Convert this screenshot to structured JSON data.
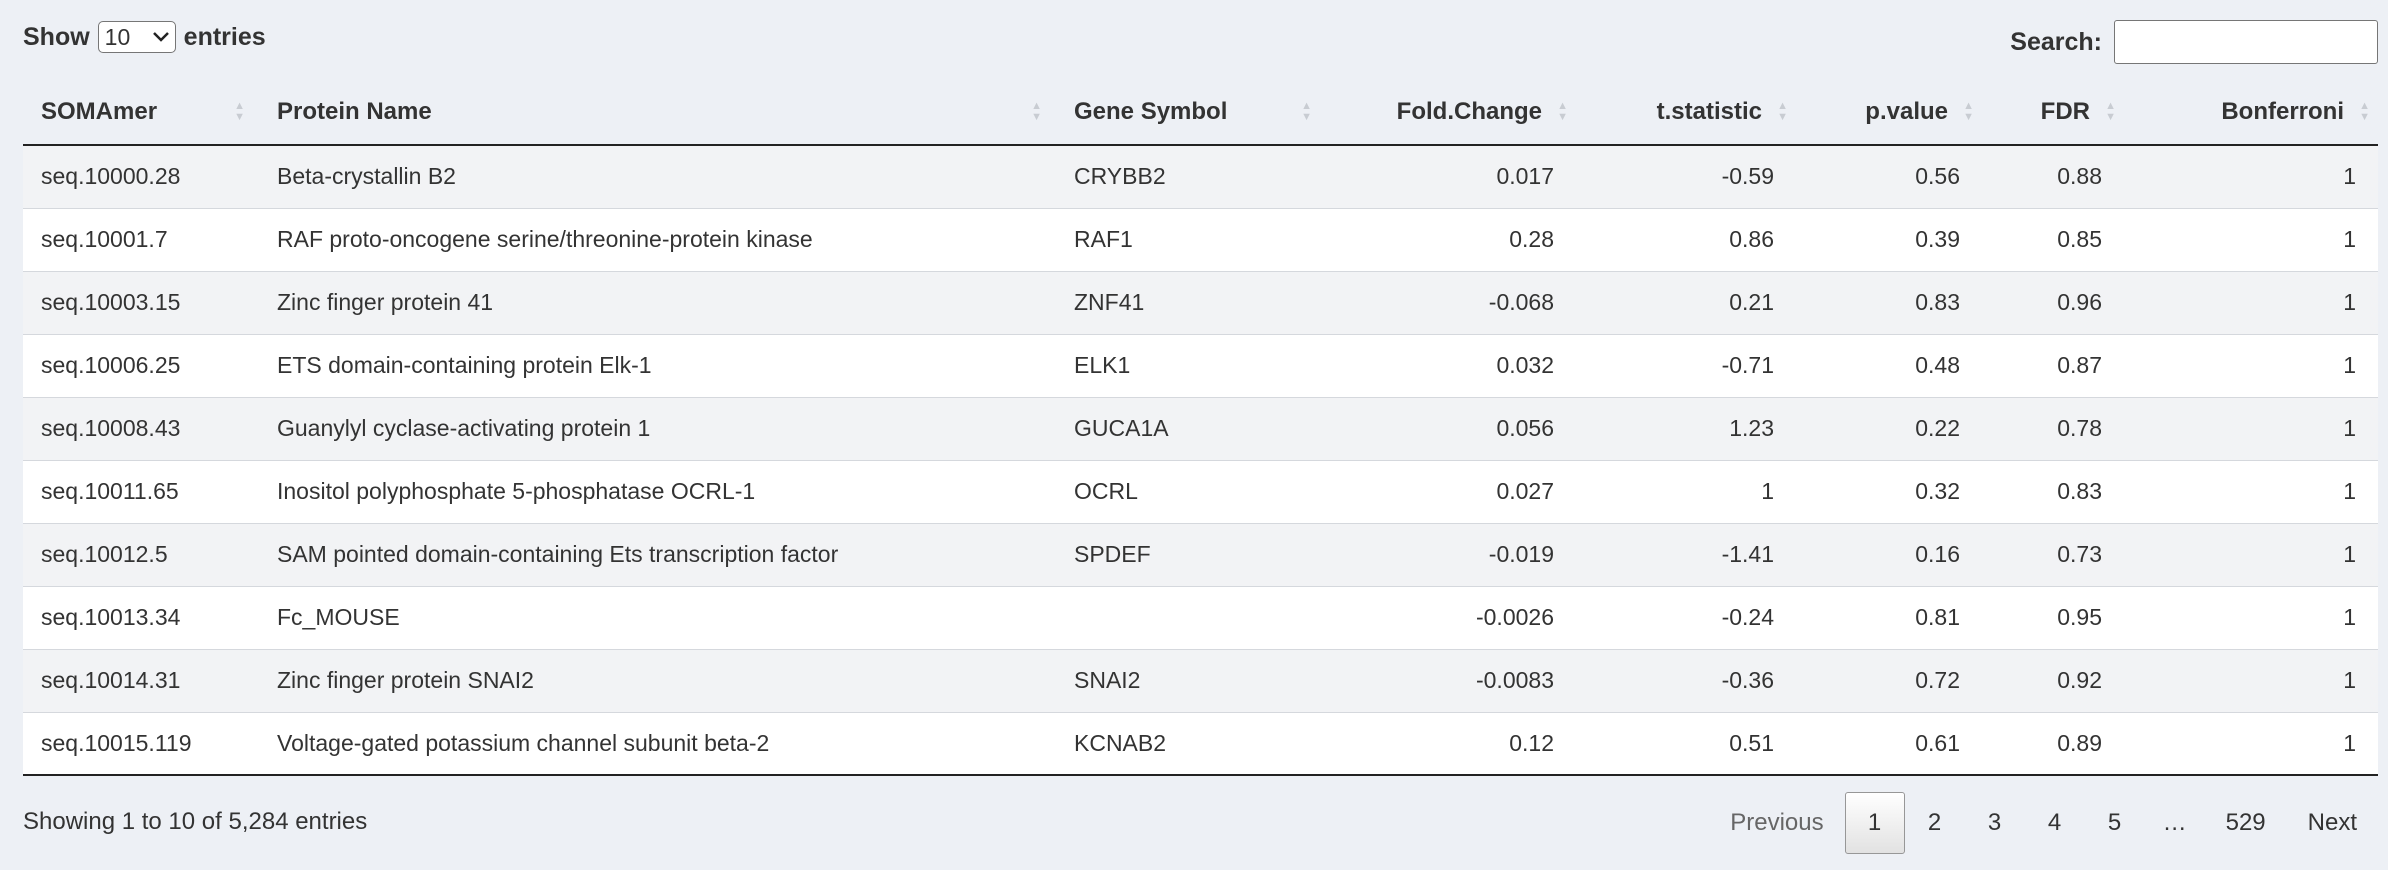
{
  "length_menu": {
    "show_label": "Show",
    "value": "10",
    "entries_label": "entries"
  },
  "search": {
    "label": "Search:",
    "value": ""
  },
  "columns": [
    {
      "label": "SOMAmer",
      "align": "left"
    },
    {
      "label": "Protein Name",
      "align": "left"
    },
    {
      "label": "Gene Symbol",
      "align": "left"
    },
    {
      "label": "Fold.Change",
      "align": "right"
    },
    {
      "label": "t.statistic",
      "align": "right"
    },
    {
      "label": "p.value",
      "align": "right"
    },
    {
      "label": "FDR",
      "align": "right"
    },
    {
      "label": "Bonferroni",
      "align": "right"
    }
  ],
  "rows": [
    [
      "seq.10000.28",
      "Beta-crystallin B2",
      "CRYBB2",
      "0.017",
      "-0.59",
      "0.56",
      "0.88",
      "1"
    ],
    [
      "seq.10001.7",
      "RAF proto-oncogene serine/threonine-protein kinase",
      "RAF1",
      "0.28",
      "0.86",
      "0.39",
      "0.85",
      "1"
    ],
    [
      "seq.10003.15",
      "Zinc finger protein 41",
      "ZNF41",
      "-0.068",
      "0.21",
      "0.83",
      "0.96",
      "1"
    ],
    [
      "seq.10006.25",
      "ETS domain-containing protein Elk-1",
      "ELK1",
      "0.032",
      "-0.71",
      "0.48",
      "0.87",
      "1"
    ],
    [
      "seq.10008.43",
      "Guanylyl cyclase-activating protein 1",
      "GUCA1A",
      "0.056",
      "1.23",
      "0.22",
      "0.78",
      "1"
    ],
    [
      "seq.10011.65",
      "Inositol polyphosphate 5-phosphatase OCRL-1",
      "OCRL",
      "0.027",
      "1",
      "0.32",
      "0.83",
      "1"
    ],
    [
      "seq.10012.5",
      "SAM pointed domain-containing Ets transcription factor",
      "SPDEF",
      "-0.019",
      "-1.41",
      "0.16",
      "0.73",
      "1"
    ],
    [
      "seq.10013.34",
      "Fc_MOUSE",
      "",
      "-0.0026",
      "-0.24",
      "0.81",
      "0.95",
      "1"
    ],
    [
      "seq.10014.31",
      "Zinc finger protein SNAI2",
      "SNAI2",
      "-0.0083",
      "-0.36",
      "0.72",
      "0.92",
      "1"
    ],
    [
      "seq.10015.119",
      "Voltage-gated potassium channel subunit beta-2",
      "KCNAB2",
      "0.12",
      "0.51",
      "0.61",
      "0.89",
      "1"
    ]
  ],
  "info": "Showing 1 to 10 of 5,284 entries",
  "pagination": {
    "previous": "Previous",
    "pages": [
      "1",
      "2",
      "3",
      "4",
      "5"
    ],
    "ellipsis": "…",
    "last": "529",
    "next": "Next",
    "current": "1"
  },
  "icons": {
    "sort": "sort-both-icon",
    "chevron": "chevron-down-icon"
  }
}
